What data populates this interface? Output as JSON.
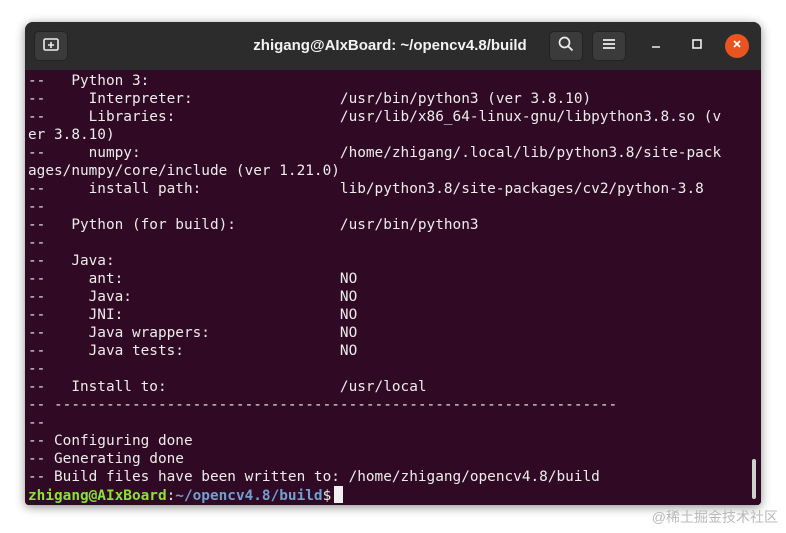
{
  "window": {
    "title": "zhigang@AIxBoard: ~/opencv4.8/build"
  },
  "titlebar": {
    "new_tab_icon": "new-tab-icon",
    "search_icon": "search-icon",
    "menu_icon": "hamburger-menu-icon",
    "minimize_icon": "minimize-icon",
    "maximize_icon": "maximize-icon",
    "close_icon": "close-icon"
  },
  "terminal": {
    "lines": [
      "--   Python 3:",
      "--     Interpreter:                 /usr/bin/python3 (ver 3.8.10)",
      "--     Libraries:                   /usr/lib/x86_64-linux-gnu/libpython3.8.so (v",
      "er 3.8.10)",
      "--     numpy:                       /home/zhigang/.local/lib/python3.8/site-pack",
      "ages/numpy/core/include (ver 1.21.0)",
      "--     install path:                lib/python3.8/site-packages/cv2/python-3.8",
      "--",
      "--   Python (for build):            /usr/bin/python3",
      "--",
      "--   Java:",
      "--     ant:                         NO",
      "--     Java:                        NO",
      "--     JNI:                         NO",
      "--     Java wrappers:               NO",
      "--     Java tests:                  NO",
      "--",
      "--   Install to:                    /usr/local",
      "-- -----------------------------------------------------------------",
      "--",
      "-- Configuring done",
      "-- Generating done",
      "-- Build files have been written to: /home/zhigang/opencv4.8/build"
    ],
    "prompt": {
      "user_host": "zhigang@AIxBoard",
      "separator": ":",
      "path": "~/opencv4.8/build",
      "symbol": "$"
    }
  },
  "watermark": "@稀土掘金技术社区",
  "colors": {
    "terminal_bg": "#300a24",
    "titlebar_bg": "#2c2c2c",
    "close_button": "#e95420",
    "prompt_user": "#8ae234",
    "prompt_path": "#729fcf"
  }
}
